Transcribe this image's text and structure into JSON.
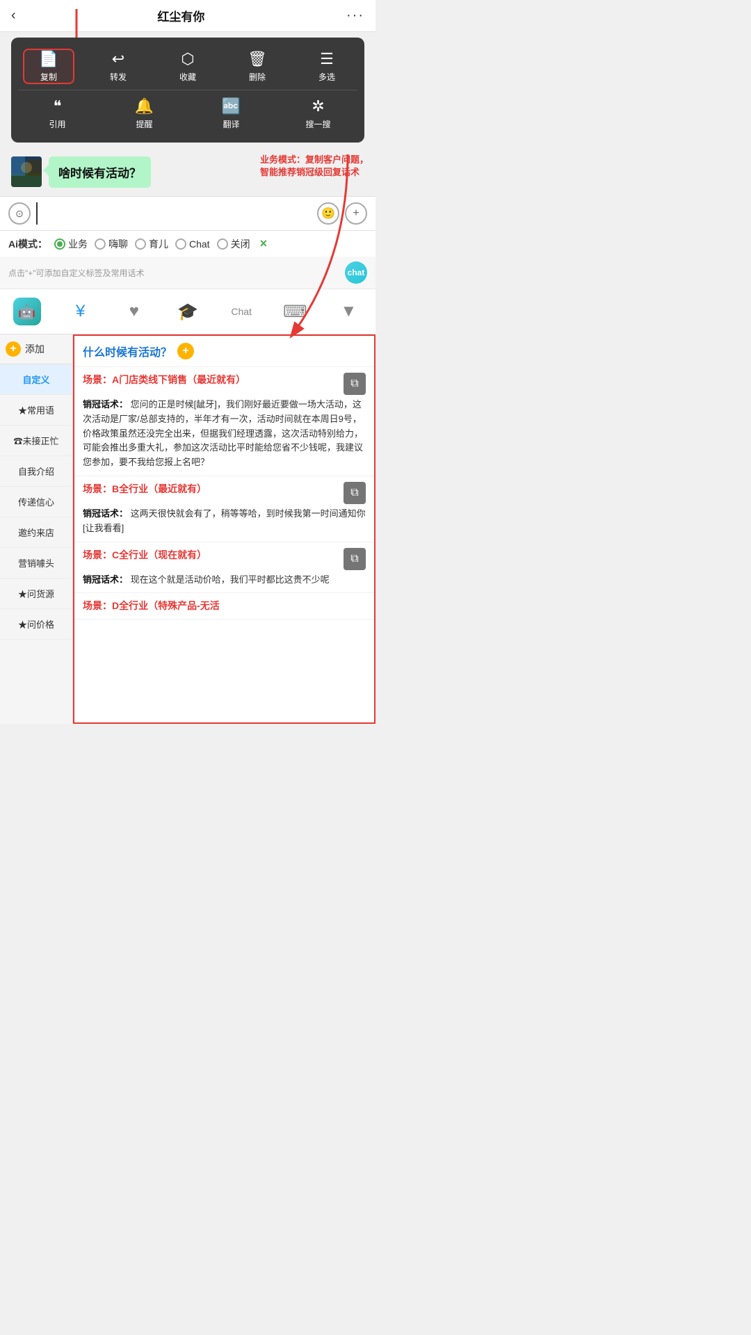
{
  "header": {
    "back_icon": "‹",
    "title": "红尘有你",
    "more_icon": "···"
  },
  "context_menu": {
    "row1": [
      {
        "icon": "📄",
        "label": "复制",
        "highlighted": true
      },
      {
        "icon": "↩",
        "label": "转发",
        "highlighted": false
      },
      {
        "icon": "🎁",
        "label": "收藏",
        "highlighted": false
      },
      {
        "icon": "🗑",
        "label": "删除",
        "highlighted": false
      },
      {
        "icon": "☰",
        "label": "多选",
        "highlighted": false
      }
    ],
    "row2": [
      {
        "icon": "❝",
        "label": "引用",
        "highlighted": false
      },
      {
        "icon": "🔔",
        "label": "提醒",
        "highlighted": false
      },
      {
        "icon": "🔤",
        "label": "翻译",
        "highlighted": false
      },
      {
        "icon": "✲",
        "label": "搜一搜",
        "highlighted": false
      }
    ]
  },
  "chat": {
    "bubble_text": "啥时候有活动？",
    "annotation": "业务模式：复制客户问题，\n智能推荐销冠级回复话术"
  },
  "input_bar": {
    "voice_icon": "⊙",
    "placeholder": "",
    "emoji_icon": "🙂",
    "plus_icon": "+"
  },
  "ai_mode": {
    "label": "Ai模式：",
    "options": [
      {
        "id": "business",
        "label": "业务",
        "active": true
      },
      {
        "id": "casual",
        "label": "嗨聊",
        "active": false
      },
      {
        "id": "parenting",
        "label": "育儿",
        "active": false
      },
      {
        "id": "chat",
        "label": "Chat",
        "active": false
      },
      {
        "id": "off",
        "label": "关闭",
        "active": false
      }
    ],
    "close_icon": "×"
  },
  "tips": {
    "text": "点击\"+\"可添加自定义标签及常用话术",
    "icon_label": "chat"
  },
  "toolbar": {
    "items": [
      {
        "icon": "🤖",
        "type": "robot",
        "active": false
      },
      {
        "icon": "¥",
        "type": "money",
        "active": true
      },
      {
        "icon": "♥",
        "type": "heart",
        "active": false
      },
      {
        "icon": "🎓",
        "type": "graduation",
        "active": false
      },
      {
        "icon": "Chat",
        "type": "chat-text",
        "active": false
      },
      {
        "icon": "⌨",
        "type": "keyboard",
        "active": false
      },
      {
        "icon": "▼",
        "type": "dropdown",
        "active": false
      }
    ]
  },
  "sidebar": {
    "add_label": "添加",
    "items": [
      {
        "label": "自定义",
        "active": true
      },
      {
        "label": "★常用语",
        "active": false
      },
      {
        "label": "☎未接正忙",
        "active": false
      },
      {
        "label": "自我介绍",
        "active": false
      },
      {
        "label": "传递信心",
        "active": false
      },
      {
        "label": "邀约来店",
        "active": false
      },
      {
        "label": "营销噱头",
        "active": false
      },
      {
        "label": "★问货源",
        "active": false
      },
      {
        "label": "★问价格",
        "active": false
      }
    ]
  },
  "right_panel": {
    "question": "什么时候有活动？",
    "plus_icon": "+",
    "scenes": [
      {
        "title": "场景：A门店类线下销售（最近就有）",
        "content_label": "销冠话术：",
        "content": "您问的正是时候[龇牙]，我们刚好最近要做一场大活动，这次活动是厂家/总部支持的，半年才有一次，活动时间就在本周日9号，价格政策虽然还没完全出来，但据我们经理透露，这次活动特别给力，可能会推出多重大礼，参加这次活动比平时能给您省不少钱呢，我建议您参加，要不我给您报上名吧？"
      },
      {
        "title": "场景：B全行业（最近就有）",
        "content_label": "销冠话术：",
        "content": "这两天很快就会有了，稍等等哈，到时候我第一时间通知你[让我看看]"
      },
      {
        "title": "场景：C全行业（现在就有）",
        "content_label": "销冠话术：",
        "content": "现在这个就是活动价哈，我们平时都比这贵不少呢"
      },
      {
        "title": "场景：D全行业（特殊产品-无活",
        "content_label": "",
        "content": ""
      }
    ]
  }
}
